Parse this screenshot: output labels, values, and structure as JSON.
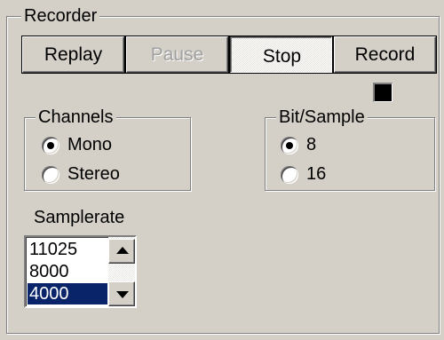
{
  "recorder": {
    "title": "Recorder",
    "buttons": {
      "replay": "Replay",
      "pause": "Pause",
      "stop": "Stop",
      "record": "Record"
    },
    "level_indicator_color": "#000000"
  },
  "channels": {
    "title": "Channels",
    "options": [
      "Mono",
      "Stereo"
    ],
    "selected": "Mono"
  },
  "bits": {
    "title": "Bit/Sample",
    "options": [
      "8",
      "16"
    ],
    "selected": "8"
  },
  "samplerate": {
    "label": "Samplerate",
    "items": [
      "11025",
      "8000",
      "4000"
    ],
    "selected": "4000"
  },
  "colors": {
    "face": "#d4d0c8",
    "selection": "#0a246a"
  }
}
